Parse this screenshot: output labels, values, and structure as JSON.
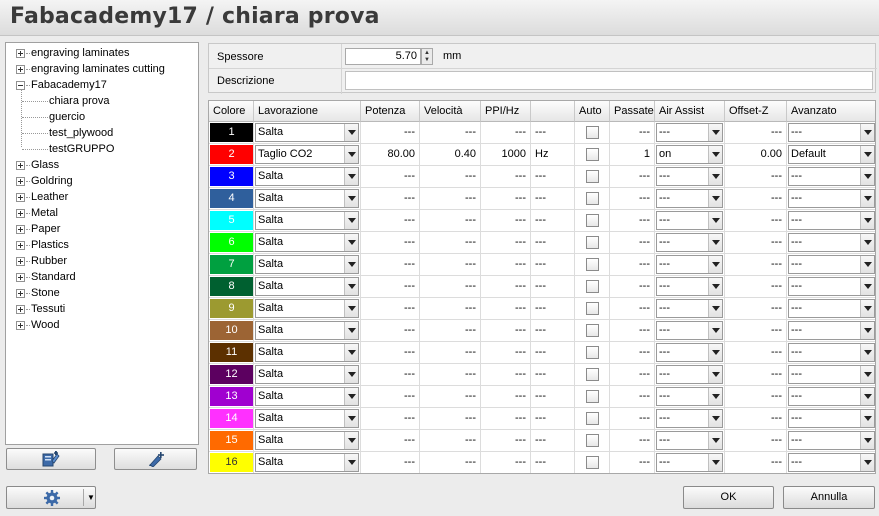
{
  "window": {
    "title": "Fabacademy17 / chiara prova"
  },
  "tree": {
    "items": [
      {
        "label": "engraving laminates",
        "expander": "plus"
      },
      {
        "label": "engraving laminates cutting",
        "expander": "plus"
      },
      {
        "label": "Fabacademy17",
        "expander": "minus"
      },
      {
        "label": "chiara prova",
        "expander": "none",
        "selected": true
      },
      {
        "label": "guercio",
        "expander": "none"
      },
      {
        "label": "test_plywood",
        "expander": "none"
      },
      {
        "label": "testGRUPPO",
        "expander": "none"
      },
      {
        "label": "Glass",
        "expander": "plus"
      },
      {
        "label": "Goldring",
        "expander": "plus"
      },
      {
        "label": "Leather",
        "expander": "plus"
      },
      {
        "label": "Metal",
        "expander": "plus"
      },
      {
        "label": "Paper",
        "expander": "plus"
      },
      {
        "label": "Plastics",
        "expander": "plus"
      },
      {
        "label": "Rubber",
        "expander": "plus"
      },
      {
        "label": "Standard",
        "expander": "plus"
      },
      {
        "label": "Stone",
        "expander": "plus"
      },
      {
        "label": "Tessuti",
        "expander": "plus"
      },
      {
        "label": "Wood",
        "expander": "plus"
      }
    ]
  },
  "tree_buttons": {
    "left_icon": "edit-material-icon",
    "right_icon": "add-material-icon"
  },
  "form": {
    "thickness_label": "Spessore",
    "thickness_value": "5.70",
    "thickness_unit": "mm",
    "description_label": "Descrizione",
    "description_value": ""
  },
  "table": {
    "headers": [
      "Colore",
      "Lavorazione",
      "Potenza",
      "Velocità",
      "PPI/Hz",
      "",
      "Auto",
      "Passate",
      "Air Assist",
      "Offset-Z",
      "Avanzato"
    ],
    "rows": [
      {
        "num": "1",
        "color": "#000000",
        "text_color": "#ffffff",
        "process": "Salta",
        "power": "---",
        "speed": "---",
        "ppi": "---",
        "unit": "---",
        "auto": false,
        "passes": "---",
        "air": "---",
        "offset": "---",
        "advanced": "---"
      },
      {
        "num": "2",
        "color": "#ff0000",
        "text_color": "#ffffff",
        "process": "Taglio CO2",
        "power": "80.00",
        "speed": "0.40",
        "ppi": "1000",
        "unit": "Hz",
        "auto": false,
        "passes": "1",
        "air": "on",
        "offset": "0.00",
        "advanced": "Default"
      },
      {
        "num": "3",
        "color": "#0000ff",
        "text_color": "#ffffff",
        "process": "Salta",
        "power": "---",
        "speed": "---",
        "ppi": "---",
        "unit": "---",
        "auto": false,
        "passes": "---",
        "air": "---",
        "offset": "---",
        "advanced": "---"
      },
      {
        "num": "4",
        "color": "#2f5f9c",
        "text_color": "#ffffff",
        "process": "Salta",
        "power": "---",
        "speed": "---",
        "ppi": "---",
        "unit": "---",
        "auto": false,
        "passes": "---",
        "air": "---",
        "offset": "---",
        "advanced": "---"
      },
      {
        "num": "5",
        "color": "#00ffff",
        "text_color": "#ffffff",
        "process": "Salta",
        "power": "---",
        "speed": "---",
        "ppi": "---",
        "unit": "---",
        "auto": false,
        "passes": "---",
        "air": "---",
        "offset": "---",
        "advanced": "---"
      },
      {
        "num": "6",
        "color": "#00ff00",
        "text_color": "#ffffff",
        "process": "Salta",
        "power": "---",
        "speed": "---",
        "ppi": "---",
        "unit": "---",
        "auto": false,
        "passes": "---",
        "air": "---",
        "offset": "---",
        "advanced": "---"
      },
      {
        "num": "7",
        "color": "#00a040",
        "text_color": "#ffffff",
        "process": "Salta",
        "power": "---",
        "speed": "---",
        "ppi": "---",
        "unit": "---",
        "auto": false,
        "passes": "---",
        "air": "---",
        "offset": "---",
        "advanced": "---"
      },
      {
        "num": "8",
        "color": "#006030",
        "text_color": "#ffffff",
        "process": "Salta",
        "power": "---",
        "speed": "---",
        "ppi": "---",
        "unit": "---",
        "auto": false,
        "passes": "---",
        "air": "---",
        "offset": "---",
        "advanced": "---"
      },
      {
        "num": "9",
        "color": "#9c9a30",
        "text_color": "#ffffff",
        "process": "Salta",
        "power": "---",
        "speed": "---",
        "ppi": "---",
        "unit": "---",
        "auto": false,
        "passes": "---",
        "air": "---",
        "offset": "---",
        "advanced": "---"
      },
      {
        "num": "10",
        "color": "#9c6434",
        "text_color": "#ffffff",
        "process": "Salta",
        "power": "---",
        "speed": "---",
        "ppi": "---",
        "unit": "---",
        "auto": false,
        "passes": "---",
        "air": "---",
        "offset": "---",
        "advanced": "---"
      },
      {
        "num": "11",
        "color": "#5c3000",
        "text_color": "#ffffff",
        "process": "Salta",
        "power": "---",
        "speed": "---",
        "ppi": "---",
        "unit": "---",
        "auto": false,
        "passes": "---",
        "air": "---",
        "offset": "---",
        "advanced": "---"
      },
      {
        "num": "12",
        "color": "#5c0060",
        "text_color": "#ffffff",
        "process": "Salta",
        "power": "---",
        "speed": "---",
        "ppi": "---",
        "unit": "---",
        "auto": false,
        "passes": "---",
        "air": "---",
        "offset": "---",
        "advanced": "---"
      },
      {
        "num": "13",
        "color": "#a000d0",
        "text_color": "#ffffff",
        "process": "Salta",
        "power": "---",
        "speed": "---",
        "ppi": "---",
        "unit": "---",
        "auto": false,
        "passes": "---",
        "air": "---",
        "offset": "---",
        "advanced": "---"
      },
      {
        "num": "14",
        "color": "#ff30ff",
        "text_color": "#ffffff",
        "process": "Salta",
        "power": "---",
        "speed": "---",
        "ppi": "---",
        "unit": "---",
        "auto": false,
        "passes": "---",
        "air": "---",
        "offset": "---",
        "advanced": "---"
      },
      {
        "num": "15",
        "color": "#ff6a00",
        "text_color": "#ffffff",
        "process": "Salta",
        "power": "---",
        "speed": "---",
        "ppi": "---",
        "unit": "---",
        "auto": false,
        "passes": "---",
        "air": "---",
        "offset": "---",
        "advanced": "---"
      },
      {
        "num": "16",
        "color": "#ffff00",
        "text_color": "#333333",
        "process": "Salta",
        "power": "---",
        "speed": "---",
        "ppi": "---",
        "unit": "---",
        "auto": false,
        "passes": "---",
        "air": "---",
        "offset": "---",
        "advanced": "---"
      }
    ]
  },
  "footer": {
    "settings_icon": "gear-icon",
    "ok_label": "OK",
    "cancel_label": "Annulla"
  }
}
